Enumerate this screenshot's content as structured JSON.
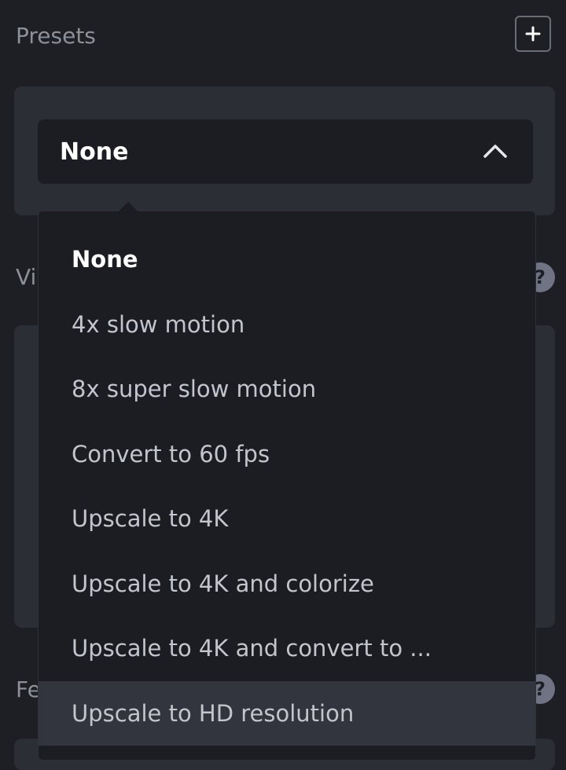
{
  "presets": {
    "title": "Presets",
    "add_icon": "plus-icon",
    "selected_value": "None",
    "chevron_icon": "chevron-up-icon",
    "options": [
      {
        "label": "None",
        "selected": true
      },
      {
        "label": "4x slow motion"
      },
      {
        "label": "8x super slow motion"
      },
      {
        "label": "Convert to 60 fps"
      },
      {
        "label": "Upscale to 4K"
      },
      {
        "label": "Upscale to 4K and colorize"
      },
      {
        "label": "Upscale to 4K and convert to ..."
      },
      {
        "label": "Upscale to HD resolution",
        "hovered": true
      }
    ]
  },
  "background": {
    "section2_label_fragment": "Vi",
    "section3_label_fragment": "Fe",
    "help_glyph": "?"
  }
}
